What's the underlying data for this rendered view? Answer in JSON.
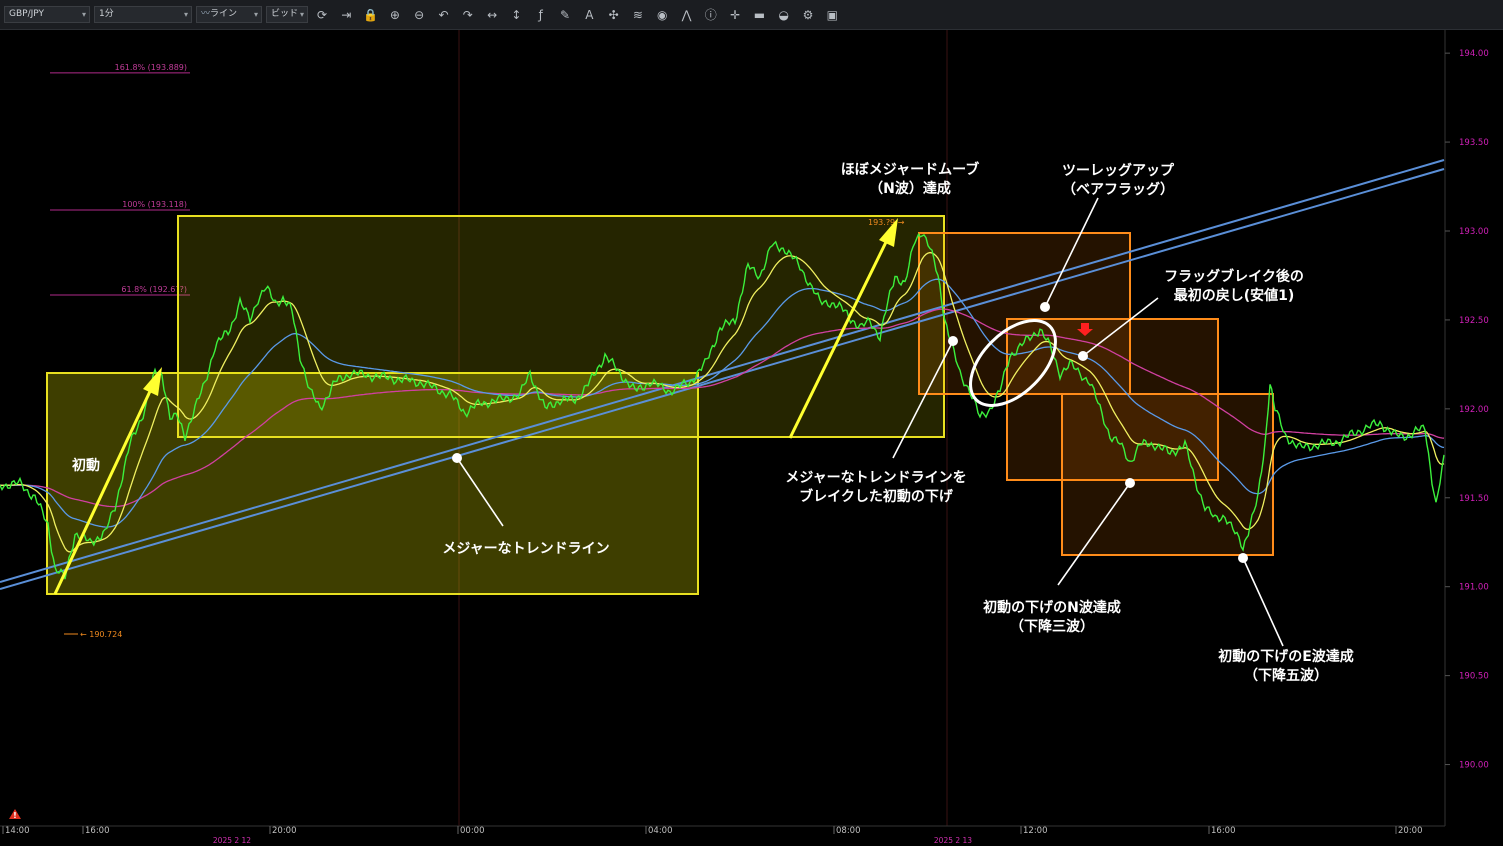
{
  "toolbar": {
    "symbol": "GBP/JPY",
    "interval": "1分",
    "chart_style": "ライン",
    "price_side": "ビッド",
    "icons": [
      "refresh-icon",
      "jump-to-latest-icon",
      "lock-icon",
      "zoom-in-icon",
      "zoom-out-icon",
      "undo-icon",
      "redo-icon",
      "horizontal-arrows-icon",
      "vertical-arrows-icon",
      "function-icon",
      "pencil-icon",
      "text-icon",
      "crosshair-icon",
      "layers-icon",
      "eye-icon",
      "indicator-icon",
      "info-icon",
      "cross-icon",
      "color-bars-icon",
      "paint-bucket-icon",
      "settings-icon",
      "save-icon"
    ]
  },
  "chart_data": {
    "type": "line",
    "symbol": "GBP/JPY",
    "y_ticks": [
      "194.00",
      "193.50",
      "193.00",
      "192.50",
      "192.00",
      "191.50",
      "191.00",
      "190.50",
      "190.00"
    ],
    "ylim": [
      189.8,
      194.2
    ],
    "x_ticks": [
      "14:00",
      "16:00",
      "20:00",
      "00:00",
      "04:00",
      "08:00",
      "12:00",
      "16:00",
      "20:00"
    ],
    "date_labels": [
      "2025 2 12",
      "2025 2 13"
    ],
    "series_colors": {
      "price": "#3cf03c",
      "ema_fast": "#f0f060",
      "ema_mid": "#5a9ae8",
      "ema_slow": "#d040a0"
    },
    "price_path": [
      [
        0,
        191.57
      ],
      [
        20,
        191.58
      ],
      [
        35,
        191.5
      ],
      [
        48,
        191.35
      ],
      [
        55,
        191.1
      ],
      [
        65,
        191.05
      ],
      [
        75,
        191.3
      ],
      [
        90,
        191.25
      ],
      [
        105,
        191.3
      ],
      [
        115,
        191.45
      ],
      [
        130,
        191.8
      ],
      [
        145,
        192.0
      ],
      [
        155,
        192.2
      ],
      [
        162,
        192.2
      ],
      [
        170,
        191.95
      ],
      [
        178,
        191.95
      ],
      [
        185,
        191.85
      ],
      [
        195,
        192.0
      ],
      [
        205,
        192.15
      ],
      [
        215,
        192.35
      ],
      [
        230,
        192.45
      ],
      [
        240,
        192.6
      ],
      [
        250,
        192.5
      ],
      [
        258,
        192.62
      ],
      [
        266,
        192.68
      ],
      [
        275,
        192.6
      ],
      [
        283,
        192.62
      ],
      [
        292,
        192.55
      ],
      [
        300,
        192.3
      ],
      [
        310,
        192.1
      ],
      [
        320,
        192.0
      ],
      [
        335,
        192.15
      ],
      [
        350,
        192.2
      ],
      [
        380,
        192.18
      ],
      [
        420,
        192.15
      ],
      [
        450,
        192.08
      ],
      [
        465,
        191.98
      ],
      [
        480,
        192.03
      ],
      [
        500,
        192.05
      ],
      [
        520,
        192.08
      ],
      [
        530,
        192.2
      ],
      [
        545,
        192.0
      ],
      [
        560,
        192.05
      ],
      [
        575,
        192.05
      ],
      [
        590,
        192.15
      ],
      [
        605,
        192.3
      ],
      [
        620,
        192.2
      ],
      [
        635,
        192.1
      ],
      [
        650,
        192.15
      ],
      [
        670,
        192.1
      ],
      [
        690,
        192.15
      ],
      [
        705,
        192.25
      ],
      [
        720,
        192.45
      ],
      [
        735,
        192.5
      ],
      [
        748,
        192.8
      ],
      [
        760,
        192.75
      ],
      [
        772,
        192.92
      ],
      [
        785,
        192.9
      ],
      [
        800,
        192.8
      ],
      [
        810,
        192.7
      ],
      [
        820,
        192.6
      ],
      [
        830,
        192.6
      ],
      [
        845,
        192.55
      ],
      [
        860,
        192.45
      ],
      [
        870,
        192.5
      ],
      [
        880,
        192.4
      ],
      [
        888,
        192.6
      ],
      [
        895,
        192.75
      ],
      [
        905,
        192.7
      ],
      [
        915,
        192.95
      ],
      [
        922,
        193.0
      ],
      [
        930,
        192.9
      ],
      [
        938,
        192.75
      ],
      [
        945,
        192.5
      ],
      [
        952,
        192.35
      ],
      [
        960,
        192.2
      ],
      [
        970,
        192.1
      ],
      [
        980,
        191.95
      ],
      [
        990,
        192.0
      ],
      [
        1000,
        192.1
      ],
      [
        1010,
        192.3
      ],
      [
        1020,
        192.35
      ],
      [
        1030,
        192.4
      ],
      [
        1040,
        192.45
      ],
      [
        1050,
        192.35
      ],
      [
        1060,
        192.2
      ],
      [
        1070,
        192.25
      ],
      [
        1080,
        192.2
      ],
      [
        1090,
        192.15
      ],
      [
        1100,
        192.0
      ],
      [
        1110,
        191.85
      ],
      [
        1120,
        191.8
      ],
      [
        1130,
        191.7
      ],
      [
        1140,
        191.8
      ],
      [
        1155,
        191.8
      ],
      [
        1170,
        191.75
      ],
      [
        1185,
        191.8
      ],
      [
        1195,
        191.6
      ],
      [
        1205,
        191.45
      ],
      [
        1215,
        191.38
      ],
      [
        1225,
        191.4
      ],
      [
        1235,
        191.3
      ],
      [
        1243,
        191.22
      ],
      [
        1250,
        191.35
      ],
      [
        1258,
        191.5
      ],
      [
        1265,
        191.8
      ],
      [
        1270,
        192.15
      ],
      [
        1275,
        192.0
      ],
      [
        1285,
        191.85
      ],
      [
        1300,
        191.78
      ],
      [
        1320,
        191.8
      ],
      [
        1340,
        191.82
      ],
      [
        1360,
        191.88
      ],
      [
        1380,
        191.92
      ],
      [
        1395,
        191.85
      ],
      [
        1410,
        191.85
      ],
      [
        1425,
        191.9
      ],
      [
        1432,
        191.6
      ],
      [
        1436,
        191.45
      ],
      [
        1444,
        191.72
      ]
    ],
    "fib_levels": [
      {
        "label": "161.8% (193.889)",
        "value": 193.889
      },
      {
        "label": "100% (193.118)",
        "value": 193.118
      },
      {
        "label": "61.8% (192.6??)",
        "value": 192.64
      }
    ],
    "price_markers": [
      {
        "label": "190.724",
        "value": 190.724
      },
      {
        "label": "193.?9",
        "value": 193.05
      }
    ],
    "annotations": [
      {
        "id": "initial-move",
        "text": "初動"
      },
      {
        "id": "major-trendline",
        "text": "メジャーなトレンドライン"
      },
      {
        "id": "near-major-move",
        "lines": [
          "ほぼメジャードムーブ",
          "（N波）達成"
        ]
      },
      {
        "id": "two-legged-up",
        "lines": [
          "ツーレッグアップ",
          "（ベアフラッグ）"
        ]
      },
      {
        "id": "first-pullback",
        "lines": [
          "フラッグブレイク後の",
          "最初の戻し(安値1)"
        ]
      },
      {
        "id": "trendline-break",
        "lines": [
          "メジャーなトレンドラインを",
          "ブレイクした初動の下げ"
        ]
      },
      {
        "id": "n-wave-down",
        "lines": [
          "初動の下げのN波達成",
          "（下降三波）"
        ]
      },
      {
        "id": "e-wave-down",
        "lines": [
          "初動の下げのE波達成",
          "（下降五波）"
        ]
      }
    ]
  }
}
